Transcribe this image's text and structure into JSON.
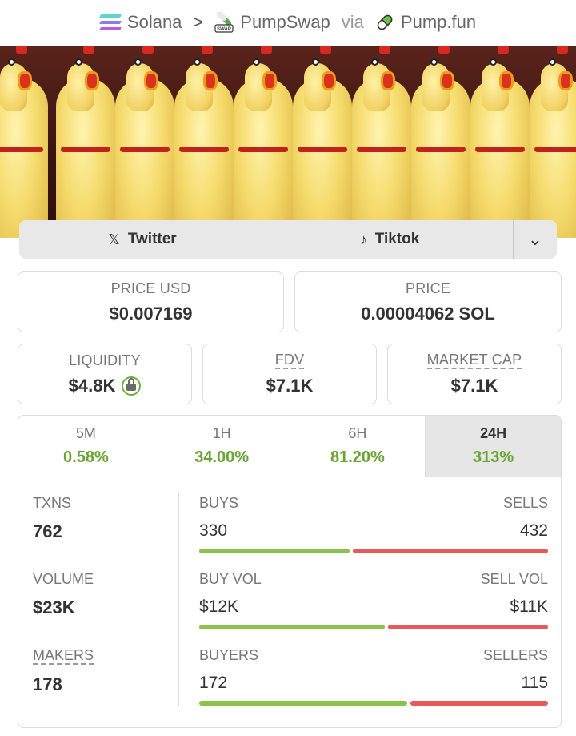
{
  "breadcrumb": {
    "chain": "Solana",
    "separator": ">",
    "dex": "PumpSwap",
    "dex_icon_text": "SWAP",
    "via": "via",
    "platform": "Pump.fun"
  },
  "socials": {
    "twitter_icon": "𝕏",
    "twitter": "Twitter",
    "tiktok_icon": "♪",
    "tiktok": "Tiktok",
    "more_icon": "⌄"
  },
  "metrics": {
    "price_usd_label": "PRICE USD",
    "price_usd": "$0.007169",
    "price_label": "PRICE",
    "price": "0.00004062 SOL",
    "liquidity_label": "LIQUIDITY",
    "liquidity": "$4.8K",
    "fdv_label": "FDV",
    "fdv": "$7.1K",
    "mcap_label": "MARKET CAP",
    "mcap": "$7.1K"
  },
  "timeframes": [
    {
      "label": "5M",
      "change": "0.58%"
    },
    {
      "label": "1H",
      "change": "34.00%"
    },
    {
      "label": "6H",
      "change": "81.20%"
    },
    {
      "label": "24H",
      "change": "313%",
      "active": true
    }
  ],
  "stats": {
    "txns_label": "TXNS",
    "txns": "762",
    "volume_label": "VOLUME",
    "volume": "$23K",
    "makers_label": "MAKERS",
    "makers": "178",
    "buys_label": "BUYS",
    "sells_label": "SELLS",
    "buys": "330",
    "sells": "432",
    "buy_vol_label": "BUY VOL",
    "sell_vol_label": "SELL VOL",
    "buy_vol": "$12K",
    "sell_vol": "$11K",
    "buyers_label": "BUYERS",
    "sellers_label": "SELLERS",
    "buyers": "172",
    "sellers": "115"
  },
  "colors": {
    "positive": "#69a533",
    "buy_bar": "#8bc34a",
    "sell_bar": "#e85a5a"
  }
}
